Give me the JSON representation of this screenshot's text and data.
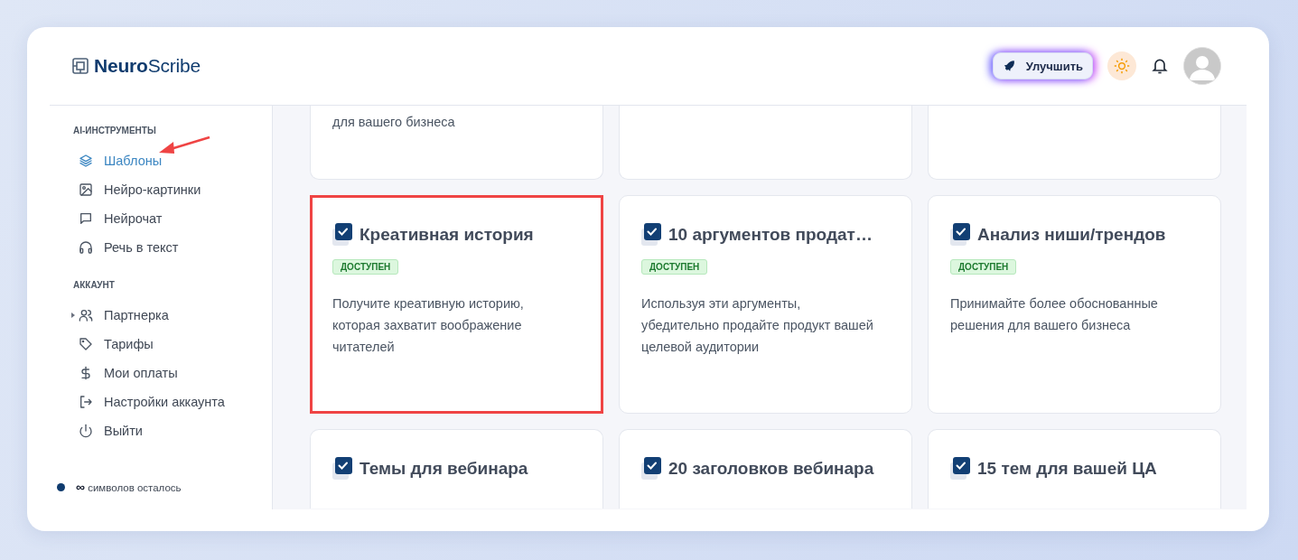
{
  "header": {
    "logo": {
      "bold": "Neuro",
      "light": "Scribe"
    },
    "upgrade_button": "Улучшить"
  },
  "sidebar": {
    "sections": [
      {
        "title": "AI-ИНСТРУМЕНТЫ",
        "items": [
          {
            "label": "Шаблоны",
            "selected": true,
            "annotated": true
          },
          {
            "label": "Нейро-картинки",
            "selected": false,
            "annotated": false
          },
          {
            "label": "Нейрочат",
            "selected": false,
            "annotated": false
          },
          {
            "label": "Речь в текст",
            "selected": false,
            "annotated": false
          }
        ]
      },
      {
        "title": "АККАУНТ",
        "items": [
          {
            "label": "Партнерка",
            "selected": false,
            "annotated": false,
            "expanded": false
          },
          {
            "label": "Тарифы",
            "selected": false,
            "annotated": false
          },
          {
            "label": "Мои оплаты",
            "selected": false,
            "annotated": false
          },
          {
            "label": "Настройки аккаунта",
            "selected": false,
            "annotated": false
          },
          {
            "label": "Выйти",
            "selected": false,
            "annotated": false
          }
        ]
      }
    ],
    "quota": {
      "amount": "∞",
      "label": "символов осталось",
      "color": "#0f3b6e"
    }
  },
  "cards": [
    {
      "kind": "partial-top",
      "description": "для вашего бизнеса",
      "highlighted": false
    },
    {
      "kind": "partial-top",
      "highlighted": false
    },
    {
      "kind": "partial-top",
      "highlighted": false
    },
    {
      "kind": "full",
      "title": "Креативная история",
      "badge": "ДОСТУПЕН",
      "description": "Получите креативную историю, которая захватит воображение читателей",
      "highlighted": true
    },
    {
      "kind": "full",
      "title": "10 аргументов продат…",
      "badge": "ДОСТУПЕН",
      "description": "Используя эти аргументы, убедительно продайте продукт вашей целевой аудитории",
      "highlighted": false
    },
    {
      "kind": "full",
      "title": "Анализ ниши/трендов",
      "badge": "ДОСТУПЕН",
      "description": "Принимайте более обоснованные решения для вашего бизнеса",
      "highlighted": false
    },
    {
      "kind": "partial-bottom",
      "title": "Темы для вебинара",
      "highlighted": false
    },
    {
      "kind": "partial-bottom",
      "title": "20 заголовков вебинара",
      "highlighted": false
    },
    {
      "kind": "partial-bottom",
      "title": "15 тем для вашей ЦА",
      "highlighted": false
    }
  ]
}
